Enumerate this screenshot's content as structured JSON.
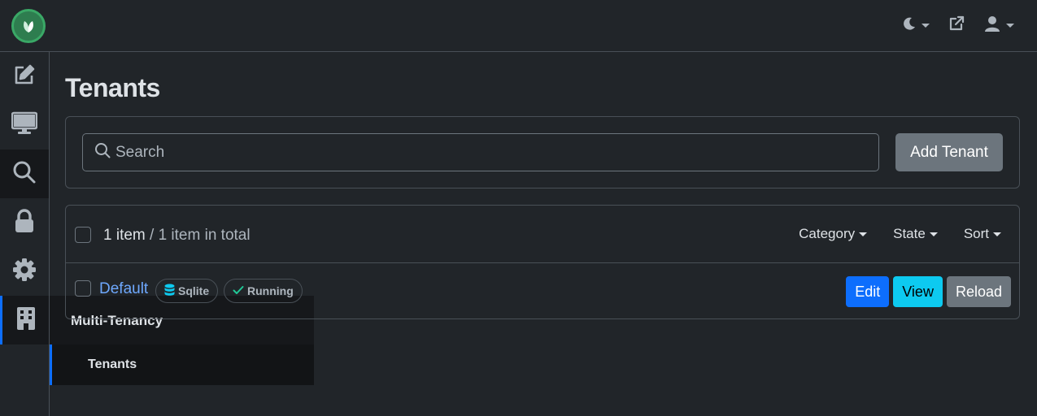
{
  "header": {
    "icons": [
      "leaf-logo-icon",
      "moon-icon",
      "external-link-icon",
      "user-icon"
    ]
  },
  "sidebar": {
    "items": [
      {
        "icon": "edit-icon"
      },
      {
        "icon": "desktop-icon"
      },
      {
        "icon": "search-icon"
      },
      {
        "icon": "lock-icon"
      },
      {
        "icon": "gear-icon"
      },
      {
        "icon": "building-icon"
      }
    ]
  },
  "flyout": {
    "title": "Multi-Tenancy",
    "item": "Tenants"
  },
  "page": {
    "title": "Tenants"
  },
  "search": {
    "placeholder": "Search",
    "add_label": "Add Tenant"
  },
  "list": {
    "count_label": "1 item",
    "total_label": " / 1 item in total",
    "filters": {
      "category": "Category",
      "state": "State",
      "sort": "Sort"
    },
    "rows": [
      {
        "name": "Default",
        "db_badge": "Sqlite",
        "state_badge": "Running",
        "actions": {
          "edit": "Edit",
          "view": "View",
          "reload": "Reload"
        }
      }
    ]
  },
  "colors": {
    "background": "#212529",
    "primary": "#0d6efd",
    "info": "#0dcaf0",
    "secondary": "#6c757d",
    "success": "#198754"
  }
}
